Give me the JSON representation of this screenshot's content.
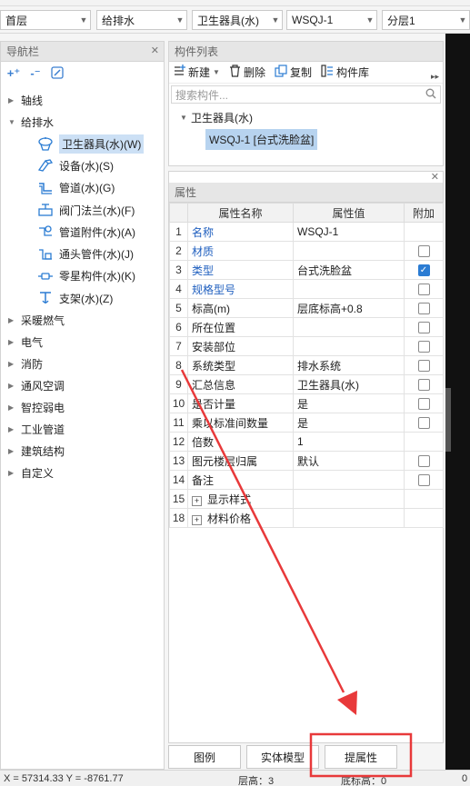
{
  "dropdowns": [
    {
      "value": "首层"
    },
    {
      "value": "给排水"
    },
    {
      "value": "卫生器具(水)"
    },
    {
      "value": "WSQJ-1"
    },
    {
      "value": "分层1"
    }
  ],
  "nav": {
    "title": "导航栏",
    "tools": [
      "+",
      "-",
      "edit"
    ],
    "categories_top": [
      {
        "label": "轴线"
      },
      {
        "label": "给排水"
      }
    ],
    "sub_items": [
      {
        "label": "卫生器具(水)(W)",
        "icon": "sanitary-icon"
      },
      {
        "label": "设备(水)(S)",
        "icon": "equipment-icon"
      },
      {
        "label": "管道(水)(G)",
        "icon": "pipe-icon"
      },
      {
        "label": "阀门法兰(水)(F)",
        "icon": "valve-icon"
      },
      {
        "label": "管道附件(水)(A)",
        "icon": "pipe-fitting-icon"
      },
      {
        "label": "通头管件(水)(J)",
        "icon": "tee-fitting-icon"
      },
      {
        "label": "零星构件(水)(K)",
        "icon": "misc-component-icon"
      },
      {
        "label": "支架(水)(Z)",
        "icon": "bracket-icon"
      }
    ],
    "categories_bottom": [
      {
        "label": "采暖燃气"
      },
      {
        "label": "电气"
      },
      {
        "label": "消防"
      },
      {
        "label": "通风空调"
      },
      {
        "label": "智控弱电"
      },
      {
        "label": "工业管道"
      },
      {
        "label": "建筑结构"
      },
      {
        "label": "自定义"
      }
    ]
  },
  "component_list": {
    "title": "构件列表",
    "toolbar": {
      "new": "新建",
      "delete": "删除",
      "copy": "复制",
      "library": "构件库"
    },
    "search_placeholder": "搜索构件...",
    "tree_root": "卫生器具(水)",
    "tree_item": "WSQJ-1 [台式洗脸盆]"
  },
  "properties": {
    "title": "属性",
    "columns": [
      "属性名称",
      "属性值",
      "附加"
    ],
    "rows": [
      {
        "num": "1",
        "name": "名称",
        "value": "WSQJ-1",
        "blue": true,
        "checkbox": null
      },
      {
        "num": "2",
        "name": "材质",
        "value": "",
        "blue": true,
        "checkbox": false
      },
      {
        "num": "3",
        "name": "类型",
        "value": "台式洗脸盆",
        "blue": true,
        "checkbox": true
      },
      {
        "num": "4",
        "name": "规格型号",
        "value": "",
        "blue": true,
        "checkbox": false
      },
      {
        "num": "5",
        "name": "标高(m)",
        "value": "层底标高+0.8",
        "blue": false,
        "checkbox": false
      },
      {
        "num": "6",
        "name": "所在位置",
        "value": "",
        "blue": false,
        "checkbox": false
      },
      {
        "num": "7",
        "name": "安装部位",
        "value": "",
        "blue": false,
        "checkbox": false
      },
      {
        "num": "8",
        "name": "系统类型",
        "value": "排水系统",
        "blue": false,
        "checkbox": false
      },
      {
        "num": "9",
        "name": "汇总信息",
        "value": "卫生器具(水)",
        "blue": false,
        "checkbox": false
      },
      {
        "num": "10",
        "name": "是否计量",
        "value": "是",
        "blue": false,
        "checkbox": false
      },
      {
        "num": "11",
        "name": "乘以标准间数量",
        "value": "是",
        "blue": false,
        "checkbox": false
      },
      {
        "num": "12",
        "name": "倍数",
        "value": "1",
        "blue": false,
        "checkbox": null
      },
      {
        "num": "13",
        "name": "图元楼层归属",
        "value": "默认",
        "blue": false,
        "checkbox": false
      },
      {
        "num": "14",
        "name": "备注",
        "value": "",
        "blue": false,
        "checkbox": false
      },
      {
        "num": "15",
        "name": "显示样式",
        "value": "",
        "blue": false,
        "checkbox": null,
        "expand": true
      },
      {
        "num": "18",
        "name": "材料价格",
        "value": "",
        "blue": false,
        "checkbox": null,
        "expand": true
      }
    ]
  },
  "bottom_tabs": [
    {
      "label": "图例"
    },
    {
      "label": "实体模型"
    },
    {
      "label": "提属性"
    }
  ],
  "status_bar": {
    "coords": "X = 57314.33 Y = -8761.77",
    "floor_height": "层高：3",
    "base_elevation": "底标高：0",
    "right_value": "0"
  },
  "colors": {
    "accent": "#2b7cd3",
    "link_blue": "#1f5fbf",
    "selection": "#b7d3ef",
    "annotation_red": "#e8393a"
  }
}
